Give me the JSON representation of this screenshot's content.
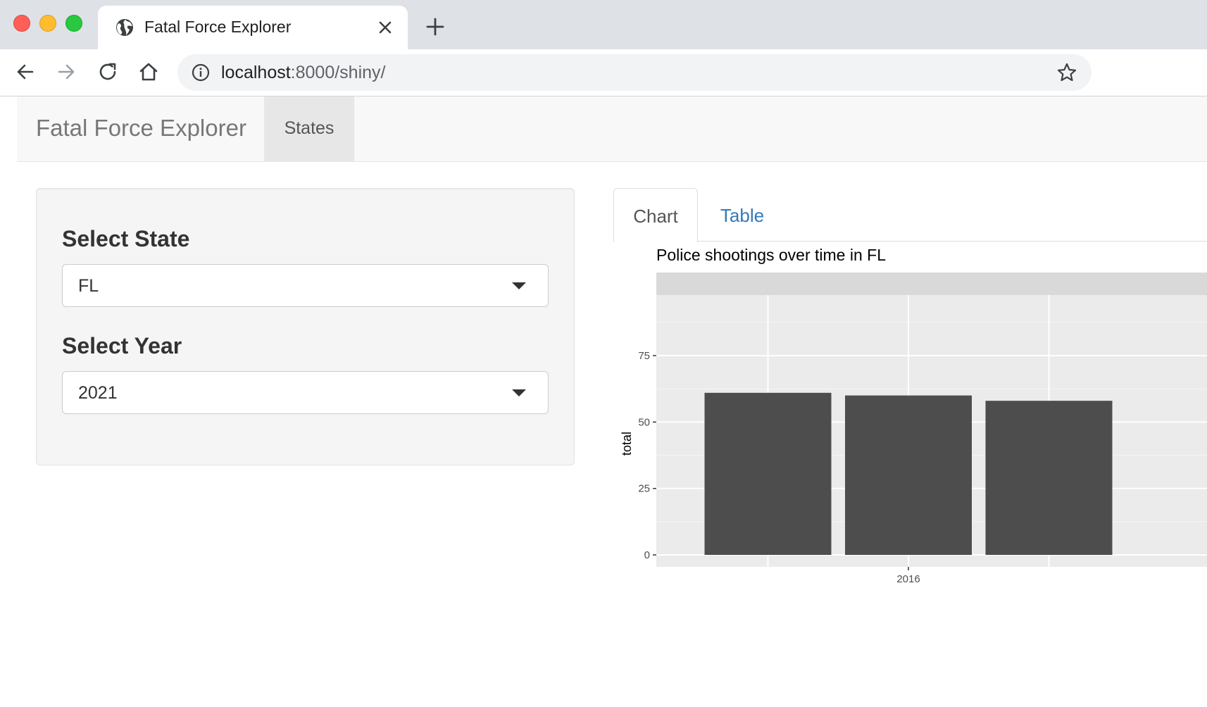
{
  "browser": {
    "tab_title": "Fatal Force Explorer",
    "url_host": "localhost",
    "url_rest": ":8000/shiny/"
  },
  "app": {
    "brand": "Fatal Force Explorer",
    "nav_tabs": [
      {
        "label": "States",
        "active": true
      }
    ]
  },
  "sidebar": {
    "state": {
      "label": "Select State",
      "value": "FL"
    },
    "year": {
      "label": "Select Year",
      "value": "2021"
    }
  },
  "main": {
    "tabs": [
      {
        "label": "Chart",
        "active": true
      },
      {
        "label": "Table",
        "active": false
      }
    ]
  },
  "colors": {
    "link": "#337ab7",
    "bar_fill": "#4d4d4d",
    "panel_bg": "#ebebeb",
    "strip_bg": "#d9d9d9"
  },
  "chart_data": {
    "type": "bar",
    "title": "Police shootings over time in FL",
    "ylabel": "total",
    "xlabel": "",
    "ylim": [
      0,
      100
    ],
    "y_ticks": [
      0,
      25,
      50,
      75
    ],
    "x_ticks": [
      {
        "label": "2016",
        "x": 2016
      }
    ],
    "x": [
      2015,
      2016,
      2017
    ],
    "values": [
      61,
      60,
      58
    ],
    "grid": true
  }
}
